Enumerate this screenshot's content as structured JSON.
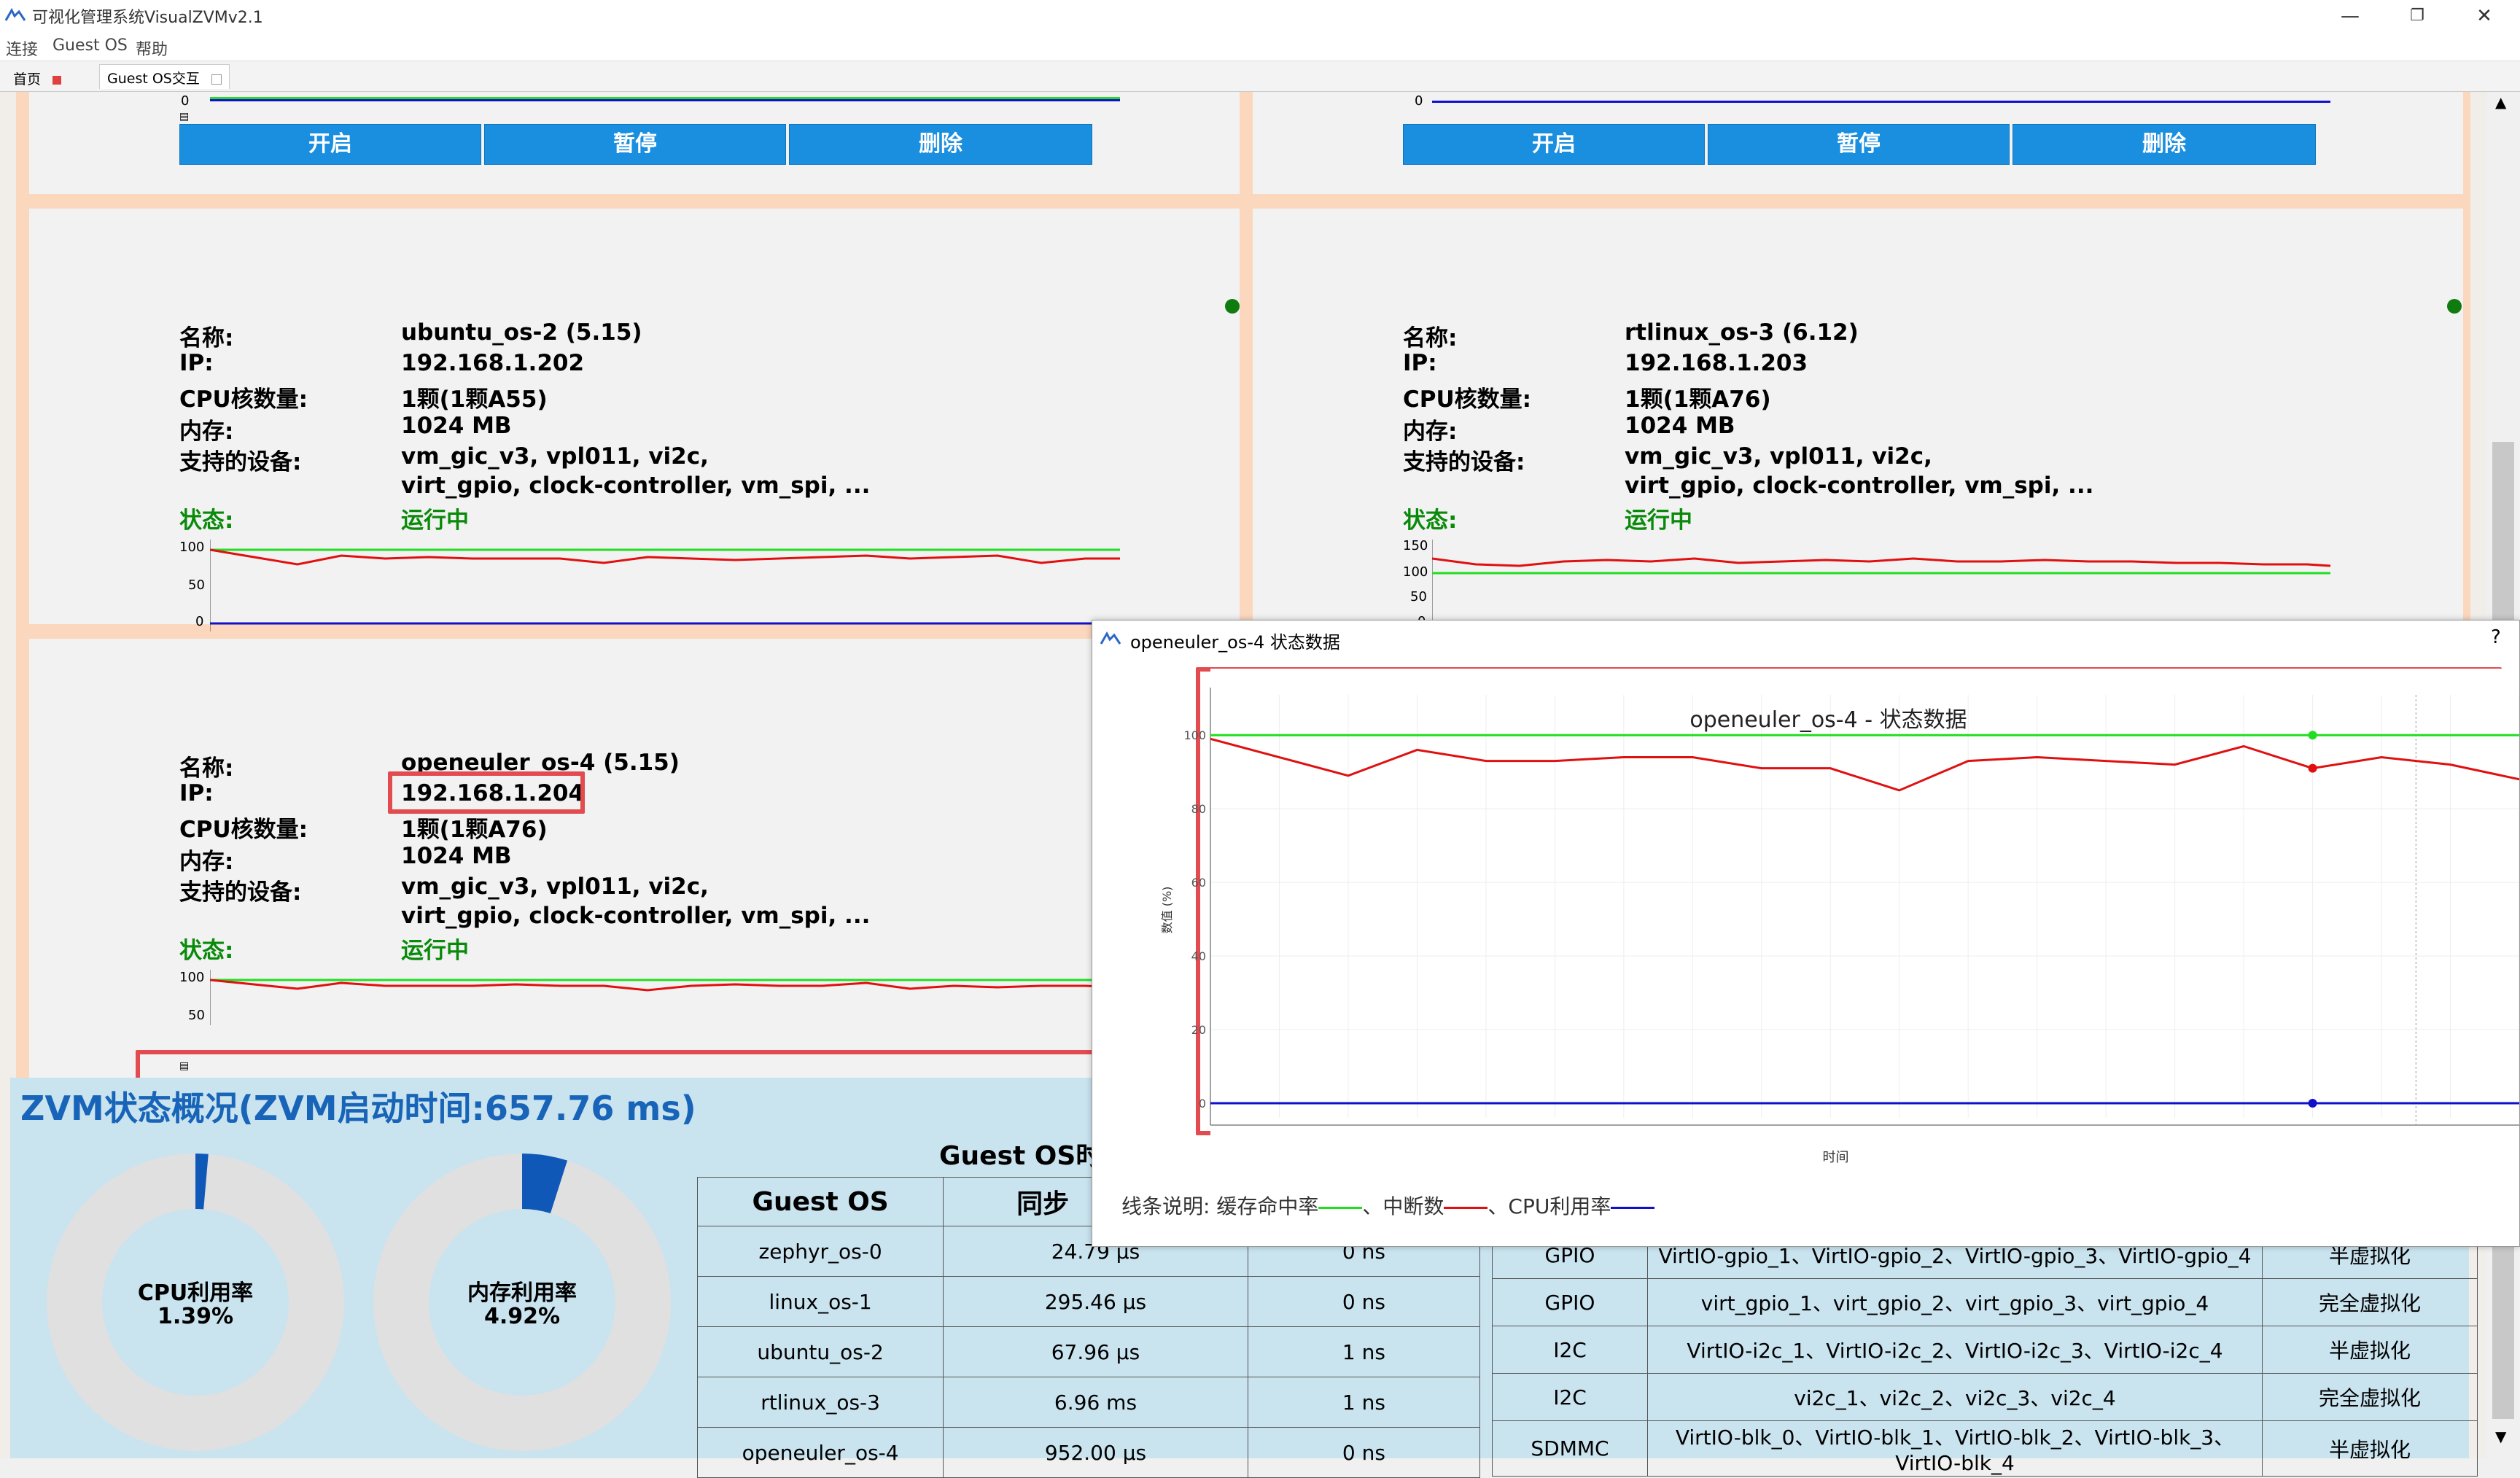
{
  "window": {
    "title": "可视化管理系统VisualZVMv2.1",
    "menus": [
      "连接",
      "Guest OS",
      "帮助"
    ],
    "tabs": [
      {
        "label": "首页"
      },
      {
        "label": "Guest OS交互"
      }
    ]
  },
  "cards": [
    {
      "name_label": "名称:",
      "name": "ubuntu_os-2 (5.15)",
      "ip_label": "IP:",
      "ip": "192.168.1.202",
      "cpu_label": "CPU核数量:",
      "cpu": "1颗(1颗A55)",
      "mem_label": "内存:",
      "mem": "1024 MB",
      "dev_label": "支持的设备:",
      "dev1": "vm_gic_v3, vpl011, vi2c,",
      "dev2": "virt_gpio, clock-controller, vm_spi, ...",
      "state_label": "状态:",
      "state": "运行中",
      "ticks": [
        "100",
        "50",
        "0"
      ]
    },
    {
      "name_label": "名称:",
      "name": "rtlinux_os-3 (6.12)",
      "ip_label": "IP:",
      "ip": "192.168.1.203",
      "cpu_label": "CPU核数量:",
      "cpu": "1颗(1颗A76)",
      "mem_label": "内存:",
      "mem": "1024 MB",
      "dev_label": "支持的设备:",
      "dev1": "vm_gic_v3, vpl011, vi2c,",
      "dev2": "virt_gpio, clock-controller, vm_spi, ...",
      "state_label": "状态:",
      "state": "运行中",
      "ticks": [
        "150",
        "100",
        "50",
        "0"
      ]
    },
    {
      "name_label": "名称:",
      "name": "openeuler_os-4 (5.15)",
      "ip_label": "IP:",
      "ip": "192.168.1.204",
      "cpu_label": "CPU核数量:",
      "cpu": "1颗(1颗A76)",
      "mem_label": "内存:",
      "mem": "1024 MB",
      "dev_label": "支持的设备:",
      "dev1": "vm_gic_v3, vpl011, vi2c,",
      "dev2": "virt_gpio, clock-controller, vm_spi, ...",
      "state_label": "状态:",
      "state": "运行中",
      "ticks": [
        "100",
        "50"
      ]
    }
  ],
  "top_ticks": [
    "0",
    "0"
  ],
  "buttons": {
    "start": "开启",
    "pause": "暂停",
    "delete": "删除"
  },
  "zvm": {
    "title": "ZVM状态概况(ZVM启动时间:657.76 ms)",
    "cpu_label": "CPU利用率",
    "cpu_value": "1.39%",
    "cpu_fraction": 0.0139,
    "mem_label": "内存利用率",
    "mem_value": "4.92%",
    "mem_fraction": 0.0492,
    "guest_table_title": "Guest OS时",
    "guest_headers": [
      "Guest OS",
      "同步"
    ],
    "guest_rows": [
      [
        "zephyr_os-0",
        "24.79 μs",
        "0 ns"
      ],
      [
        "linux_os-1",
        "295.46 μs",
        "0 ns"
      ],
      [
        "ubuntu_os-2",
        "67.96 μs",
        "1 ns"
      ],
      [
        "rtlinux_os-3",
        "6.96 ms",
        "1 ns"
      ],
      [
        "openeuler_os-4",
        "952.00 μs",
        "0 ns"
      ]
    ],
    "dev_rows": [
      [
        "GPIO",
        "VirtIO-gpio_1、VirtIO-gpio_2、VirtIO-gpio_3、VirtIO-gpio_4",
        "半虚拟化"
      ],
      [
        "GPIO",
        "virt_gpio_1、virt_gpio_2、virt_gpio_3、virt_gpio_4",
        "完全虚拟化"
      ],
      [
        "I2C",
        "VirtIO-i2c_1、VirtIO-i2c_2、VirtIO-i2c_3、VirtIO-i2c_4",
        "半虚拟化"
      ],
      [
        "I2C",
        "vi2c_1、vi2c_2、vi2c_3、vi2c_4",
        "完全虚拟化"
      ],
      [
        "SDMMC",
        "VirtIO-blk_0、VirtIO-blk_1、VirtIO-blk_2、VirtIO-blk_3、VirtIO-blk_4",
        "半虚拟化"
      ]
    ]
  },
  "dialog": {
    "title": "openeuler_os-4 状态数据",
    "help": "?",
    "legend_prefix": "线条说明:",
    "legend": [
      "缓存命中率",
      "中断数",
      "CPU利用率"
    ]
  },
  "colors": {
    "button": "#1a8fe0",
    "running": "#0a8a0a",
    "cache_hit": "#22dd22",
    "interrupts": "#e01010",
    "cpu": "#1010cc",
    "highlight": "#e24b4f"
  },
  "chart_data": {
    "type": "line",
    "title": "openeuler_os-4 - 状态数据",
    "xlabel": "时间",
    "ylabel": "数值 (%)",
    "yticks": [
      "100",
      "80",
      "60",
      "40",
      "20",
      "0"
    ],
    "ylim": [
      0,
      105
    ],
    "grid": true,
    "legend": "bottom",
    "series": [
      {
        "name": "缓存命中率",
        "values": [
          100,
          100,
          100,
          100,
          100,
          100,
          100,
          100,
          100,
          100,
          100,
          100,
          100,
          100,
          100,
          100,
          100,
          100,
          100,
          100
        ]
      },
      {
        "name": "中断数",
        "values": [
          99,
          94,
          89,
          96,
          93,
          93,
          94,
          94,
          91,
          91,
          85,
          93,
          94,
          93,
          92,
          97,
          91,
          94,
          92,
          88
        ]
      },
      {
        "name": "CPU利用率",
        "values": [
          0,
          0,
          0,
          0,
          0,
          0,
          0,
          0,
          0,
          0,
          0,
          0,
          0,
          0,
          0,
          0,
          0,
          0,
          0,
          0
        ]
      }
    ]
  }
}
